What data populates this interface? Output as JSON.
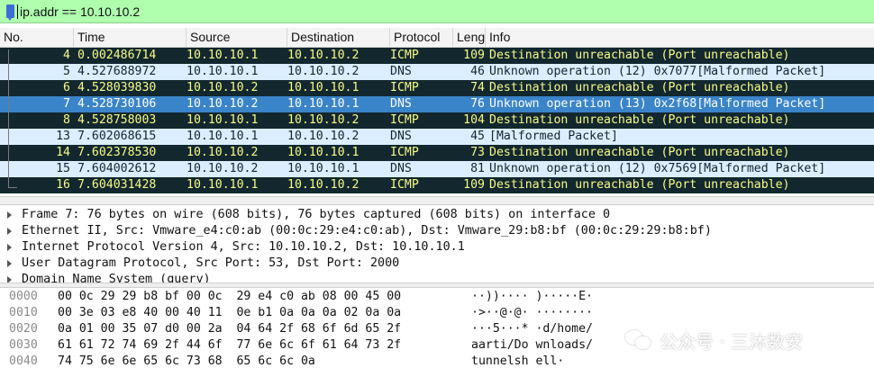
{
  "filter": {
    "value": "ip.addr == 10.10.10.2"
  },
  "columns": [
    "No.",
    "Time",
    "Source",
    "Destination",
    "Protocol",
    "Leng",
    "Info"
  ],
  "packets": [
    {
      "no": "4",
      "time": "0.002486714",
      "src": "10.10.10.1",
      "dst": "10.10.10.2",
      "proto": "ICMP",
      "len": "109",
      "info": "Destination unreachable (Port unreachable)",
      "style": "icmp"
    },
    {
      "no": "5",
      "time": "4.527688972",
      "src": "10.10.10.1",
      "dst": "10.10.10.2",
      "proto": "DNS",
      "len": "46",
      "info": "Unknown operation (12) 0x7077[Malformed Packet]",
      "style": "dns"
    },
    {
      "no": "6",
      "time": "4.528039830",
      "src": "10.10.10.2",
      "dst": "10.10.10.1",
      "proto": "ICMP",
      "len": "74",
      "info": "Destination unreachable (Port unreachable)",
      "style": "icmp"
    },
    {
      "no": "7",
      "time": "4.528730106",
      "src": "10.10.10.2",
      "dst": "10.10.10.1",
      "proto": "DNS",
      "len": "76",
      "info": "Unknown operation (13) 0x2f68[Malformed Packet]",
      "style": "sel"
    },
    {
      "no": "8",
      "time": "4.528758003",
      "src": "10.10.10.1",
      "dst": "10.10.10.2",
      "proto": "ICMP",
      "len": "104",
      "info": "Destination unreachable (Port unreachable)",
      "style": "icmp"
    },
    {
      "no": "13",
      "time": "7.602068615",
      "src": "10.10.10.1",
      "dst": "10.10.10.2",
      "proto": "DNS",
      "len": "45",
      "info": "[Malformed Packet]",
      "style": "dns"
    },
    {
      "no": "14",
      "time": "7.602378530",
      "src": "10.10.10.2",
      "dst": "10.10.10.1",
      "proto": "ICMP",
      "len": "73",
      "info": "Destination unreachable (Port unreachable)",
      "style": "icmp"
    },
    {
      "no": "15",
      "time": "7.604002612",
      "src": "10.10.10.2",
      "dst": "10.10.10.1",
      "proto": "DNS",
      "len": "81",
      "info": "Unknown operation (12) 0x7569[Malformed Packet]",
      "style": "dns"
    },
    {
      "no": "16",
      "time": "7.604031428",
      "src": "10.10.10.1",
      "dst": "10.10.10.2",
      "proto": "ICMP",
      "len": "109",
      "info": "Destination unreachable (Port unreachable)",
      "style": "icmp"
    }
  ],
  "details": [
    "Frame 7: 76 bytes on wire (608 bits), 76 bytes captured (608 bits) on interface 0",
    "Ethernet II, Src: Vmware_e4:c0:ab (00:0c:29:e4:c0:ab), Dst: Vmware_29:b8:bf (00:0c:29:29:b8:bf)",
    "Internet Protocol Version 4, Src: 10.10.10.2, Dst: 10.10.10.1",
    "User Datagram Protocol, Src Port: 53, Dst Port: 2000",
    "Domain Name System (query)"
  ],
  "hex": [
    {
      "off": "0000",
      "bytes": "00 0c 29 29 b8 bf 00 0c  29 e4 c0 ab 08 00 45 00",
      "ascii": "··))···· )·····E·"
    },
    {
      "off": "0010",
      "bytes": "00 3e 03 e8 40 00 40 11  0e b1 0a 0a 0a 02 0a 0a",
      "ascii": "·>··@·@· ········"
    },
    {
      "off": "0020",
      "bytes": "0a 01 00 35 07 d0 00 2a  04 64 2f 68 6f 6d 65 2f",
      "ascii": "···5···* ·d/home/"
    },
    {
      "off": "0030",
      "bytes": "61 61 72 74 69 2f 44 6f  77 6e 6c 6f 61 64 73 2f",
      "ascii": "aarti/Do wnloads/"
    },
    {
      "off": "0040",
      "bytes": "74 75 6e 6e 65 6c 73 68  65 6c 6c 0a",
      "ascii": "tunnelsh ell·"
    }
  ],
  "watermark": {
    "text": "公众号 · 三沐数安"
  }
}
